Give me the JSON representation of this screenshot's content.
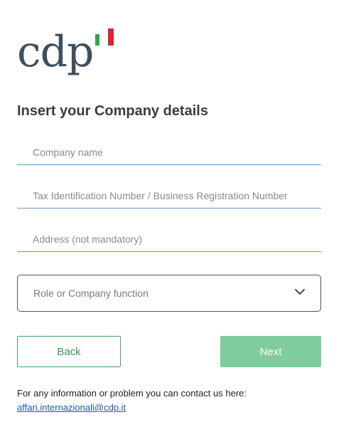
{
  "brand": {
    "logo_text": "cdp",
    "flag_colors": [
      "#2aa84a",
      "#ffffff",
      "#d7262c"
    ]
  },
  "form": {
    "title": "Insert your Company details",
    "company_name_placeholder": "Company name",
    "tax_id_placeholder": "Tax Identification Number / Business Registration Number",
    "address_placeholder": "Address (not mandatory)",
    "role_select_placeholder": "Role or Company function"
  },
  "buttons": {
    "back_label": "Back",
    "next_label": "Next"
  },
  "contact": {
    "text": "For any information or problem you can contact us here:",
    "email": "affari.internazionali@cdp.it"
  },
  "colors": {
    "accent_green": "#4aa06a",
    "next_disabled_green": "#7fcc9c",
    "link_blue": "#1a57b8",
    "field_underline": "#6c95c2"
  }
}
